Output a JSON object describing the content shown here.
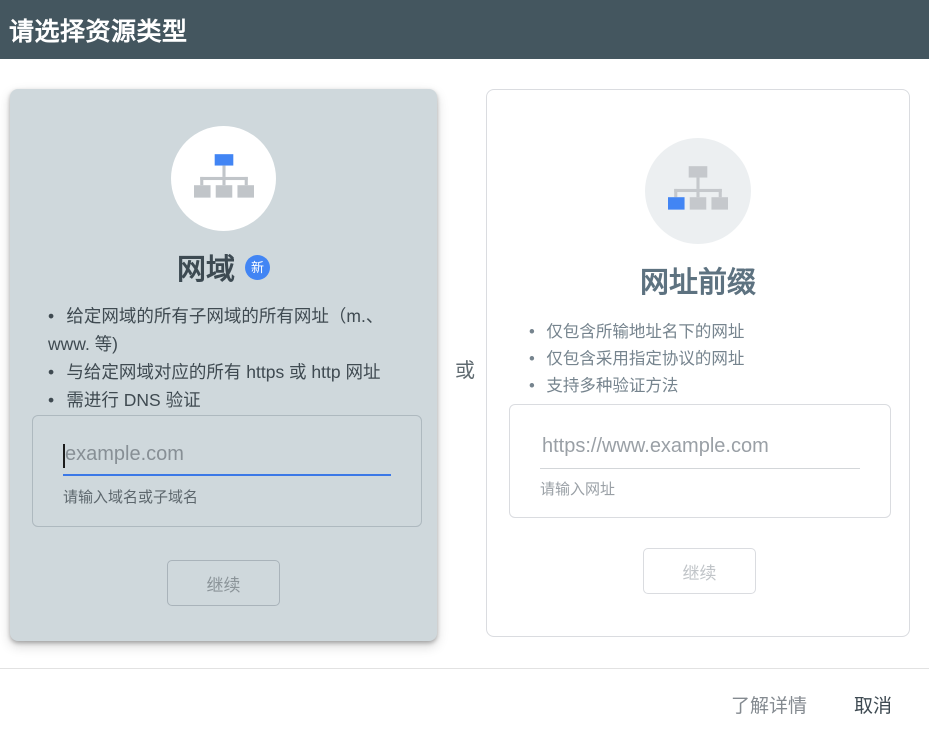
{
  "header": {
    "title": "请选择资源类型"
  },
  "separator": {
    "label": "或"
  },
  "domain_card": {
    "title": "网域",
    "badge": "新",
    "icon": "sitemap-icon-root-highlighted",
    "bullets": [
      "给定网域的所有子网域的所有网址（m.、www. 等)",
      "与给定网域对应的所有 https 或 http 网址",
      "需进行 DNS 验证"
    ],
    "input": {
      "value": "",
      "placeholder": "example.com",
      "helper": "请输入域名或子域名"
    },
    "continue_label": "继续"
  },
  "url_prefix_card": {
    "title": "网址前缀",
    "icon": "sitemap-icon-leaf-highlighted",
    "bullets": [
      "仅包含所输地址名下的网址",
      "仅包含采用指定协议的网址",
      "支持多种验证方法"
    ],
    "input": {
      "value": "",
      "placeholder": "https://www.example.com",
      "helper": "请输入网址"
    },
    "continue_label": "继续"
  },
  "footer": {
    "learn_more": "了解详情",
    "cancel": "取消"
  },
  "colors": {
    "accent_blue": "#4285f4",
    "header_bg": "#44565f",
    "selected_card_bg": "#cfd8dc",
    "icon_gray": "#c1c5c9"
  }
}
